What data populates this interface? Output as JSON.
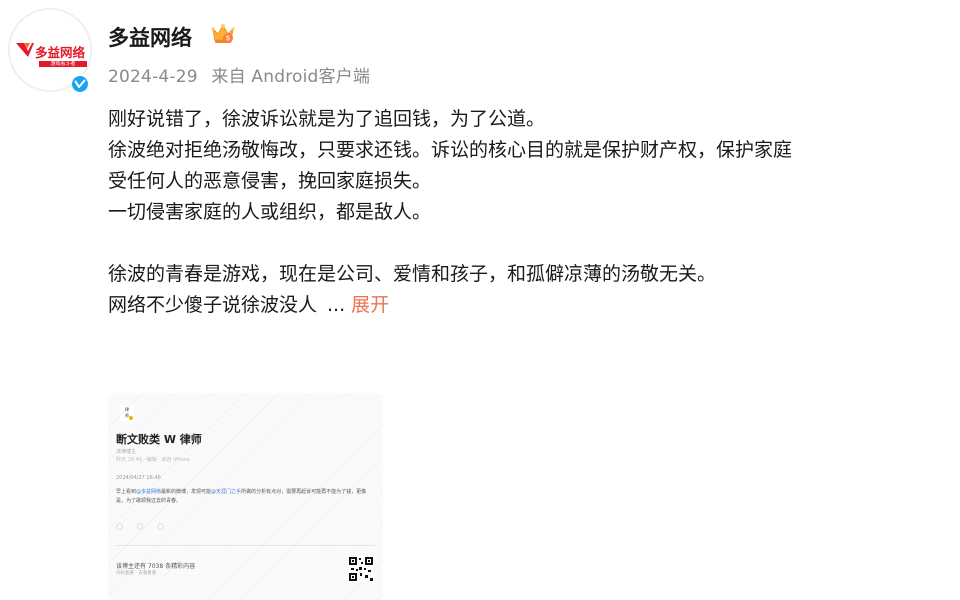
{
  "author": {
    "name": "多益网络",
    "avatar_text": "多益网络",
    "avatar_subtext": "游戏看斗者",
    "verified_badge": "blue-v-icon",
    "level_badge": "crown-icon-5"
  },
  "meta": {
    "date": "2024-4-29",
    "source": "来自 Android客户端"
  },
  "content": {
    "lines": [
      "刚好说错了，徐波诉讼就是为了追回钱，为了公道。",
      "徐波绝对拒绝汤敬悔改，只要求还钱。诉讼的核心目的就是保护财产权，保护家庭",
      "受任何人的恶意侵害，挽回家庭损失。",
      "一切侵害家庭的人或组织，都是敌人。",
      "",
      "徐波的青春是游戏，现在是公司、爱情和孩子，和孤僻凉薄的汤敬无关。"
    ],
    "last_line": "网络不少傻子说徐波没人",
    "ellipsis": "...",
    "expand_label": "展开"
  },
  "attachment": {
    "title": "断文败类 W 律师",
    "subtitle": "法律博主",
    "meta": "昨天 18:46 · 编辑 · 来自 iPhone",
    "date": "2024/04/27 16:46",
    "para_prefix": "早上看到",
    "para_link1": "@多益网络",
    "para_mid": "最新的微博，发现可能",
    "para_link2": "@天涯门之手",
    "para_suffix": "所做的分析有点对，需要再起诉可能再不能为了钱，更像是，为了歌颂我过去的青春。",
    "icons": "◯ ◯ ◯",
    "cta": "该博主还有 7038 条精彩内容",
    "cta_sub": "扫码查看 · 去看看看"
  },
  "colors": {
    "accent_link": "#eb7350",
    "brand_red": "#e21b2a",
    "verified_blue": "#1da1f2"
  }
}
